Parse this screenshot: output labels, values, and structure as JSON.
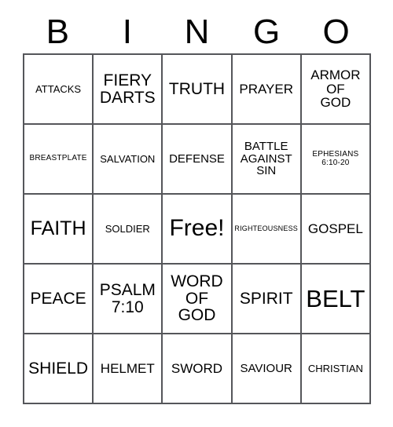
{
  "card": {
    "header_letters": [
      "B",
      "I",
      "N",
      "G",
      "O"
    ],
    "rows": [
      [
        {
          "text": "ATTACKS",
          "size": "sz-s"
        },
        {
          "text": "FIERY\nDARTS",
          "size": "sz-xl"
        },
        {
          "text": "TRUTH",
          "size": "sz-xl"
        },
        {
          "text": "PRAYER",
          "size": "sz-l"
        },
        {
          "text": "ARMOR\nOF\nGOD",
          "size": "sz-l"
        }
      ],
      [
        {
          "text": "BREASTPLATE",
          "size": "sz-xs"
        },
        {
          "text": "SALVATION",
          "size": "sz-s"
        },
        {
          "text": "DEFENSE",
          "size": "sz-m"
        },
        {
          "text": "BATTLE\nAGAINST\nSIN",
          "size": "sz-m"
        },
        {
          "text": "EPHESIANS\n6:10-20",
          "size": "sz-xs"
        }
      ],
      [
        {
          "text": "FAITH",
          "size": "sz-xxl"
        },
        {
          "text": "SOLDIER",
          "size": "sz-s"
        },
        {
          "text": "Free!",
          "size": "free"
        },
        {
          "text": "RIGHTEOUSNESS",
          "size": "sz-xxs"
        },
        {
          "text": "GOSPEL",
          "size": "sz-l"
        }
      ],
      [
        {
          "text": "PEACE",
          "size": "sz-xl"
        },
        {
          "text": "PSALM\n7:10",
          "size": "sz-xl"
        },
        {
          "text": "WORD\nOF\nGOD",
          "size": "sz-xl"
        },
        {
          "text": "SPIRIT",
          "size": "sz-xl"
        },
        {
          "text": "BELT",
          "size": "sz-huge"
        }
      ],
      [
        {
          "text": "SHIELD",
          "size": "sz-xl"
        },
        {
          "text": "HELMET",
          "size": "sz-l"
        },
        {
          "text": "SWORD",
          "size": "sz-l"
        },
        {
          "text": "SAVIOUR",
          "size": "sz-m"
        },
        {
          "text": "CHRISTIAN",
          "size": "sz-s"
        }
      ]
    ]
  },
  "colors": {
    "grid_line": "#55565a",
    "text": "#000000",
    "background": "#ffffff"
  }
}
